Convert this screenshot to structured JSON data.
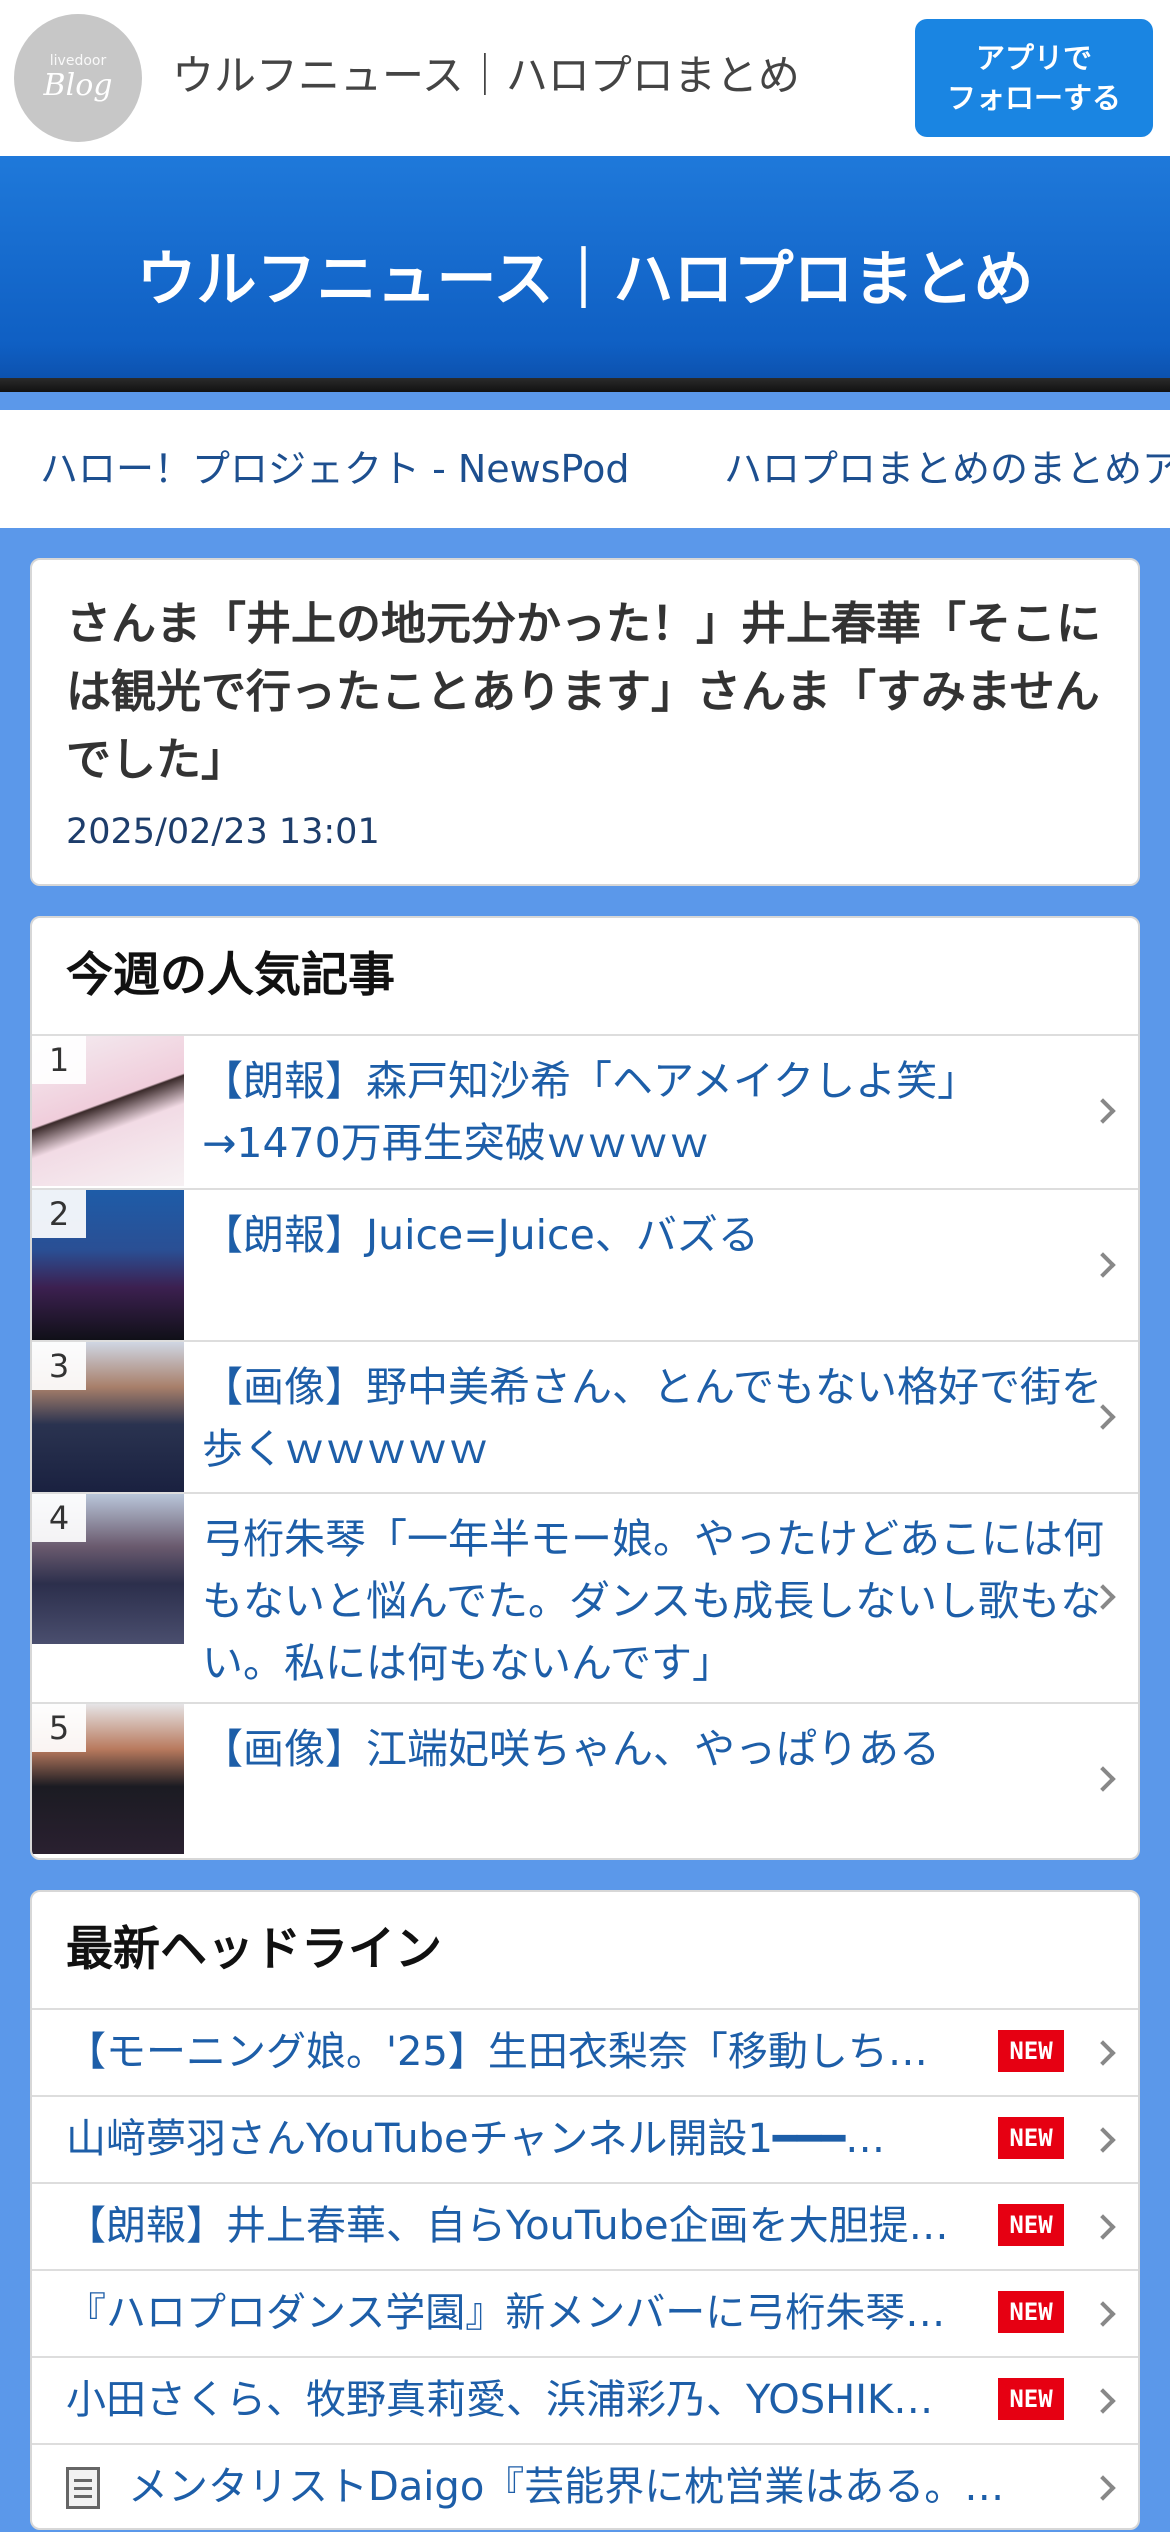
{
  "header": {
    "logo": {
      "small": "livedoor",
      "big": "Blog"
    },
    "title": "ウルフニュース｜ハロプロまとめ",
    "follow_button": "アプリで\nフォローする"
  },
  "hero": {
    "title": "ウルフニュース｜ハロプロまとめ"
  },
  "links": [
    "ハロー！プロジェクト - NewsPod",
    "ハロプロまとめのまとめア"
  ],
  "article": {
    "title": "さんま「井上の地元分かった！」井上春華「そこには観光で行ったことあります」さんま「すみませんでした」",
    "date": "2025/02/23 13:01"
  },
  "ranking": {
    "title": "今週の人気記事",
    "items": [
      {
        "rank": "1",
        "text": "【朗報】森戸知沙希「ヘアメイクしよ笑」→1470万再生突破ｗｗｗｗ"
      },
      {
        "rank": "2",
        "text": "【朗報】Juice=Juice、バズる"
      },
      {
        "rank": "3",
        "text": "【画像】野中美希さん、とんでもない格好で街を歩くｗｗｗｗｗ"
      },
      {
        "rank": "4",
        "text": "弓桁朱琴「一年半モー娘。やったけどあこには何もないと悩んでた。ダンスも成長しないし歌もない。私には何もないんです」"
      },
      {
        "rank": "5",
        "text": "【画像】江端妃咲ちゃん、やっぱりある"
      }
    ]
  },
  "headlines": {
    "title": "最新ヘッドライン",
    "new_label": "NEW",
    "items": [
      {
        "text": "【モーニング娘。'25】生田衣梨奈「移動しち…",
        "is_new": true
      },
      {
        "text": "山﨑夢羽さんYouTubeチャンネル開設1━━━…",
        "is_new": true
      },
      {
        "text": "【朗報】井上春華、自らYouTube企画を大胆提…",
        "is_new": true
      },
      {
        "text": "『ハロプロダンス学園』新メンバーに弓桁朱琴…",
        "is_new": true
      },
      {
        "text": "小田さくら、牧野真莉愛、浜浦彩乃、YOSHIK…",
        "is_new": true
      },
      {
        "text": "メンタリストDaigo『芸能界に枕営業はある。…",
        "is_new": false
      }
    ]
  },
  "colors": {
    "page_bg": "#5b98ea",
    "header_blue": "#1f79da",
    "follow_button": "#1a85e2",
    "link": "#1d5ea8",
    "new_badge": "#e60012"
  }
}
